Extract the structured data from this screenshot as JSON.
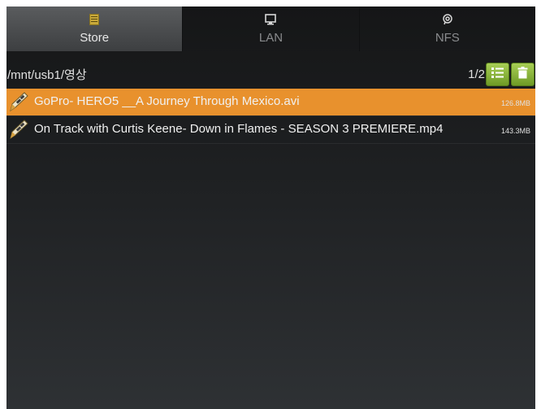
{
  "tabs": [
    {
      "label": "Store",
      "icon": "list-icon",
      "active": true
    },
    {
      "label": "LAN",
      "icon": "monitor-icon",
      "active": false
    },
    {
      "label": "NFS",
      "icon": "network-share-icon",
      "active": false
    }
  ],
  "pathbar": {
    "path": "/mnt/usb1/영상",
    "page_indicator": "1/2",
    "view_button_icon": "list-view-icon",
    "delete_button_icon": "trash-icon"
  },
  "files": [
    {
      "name": "GoPro- HERO5 __A Journey Through Mexico.avi",
      "size": "126.8MB",
      "selected": true,
      "icon": "video-file-icon"
    },
    {
      "name": "On Track with Curtis Keene- Down in Flames - SEASON 3 PREMIERE.mp4",
      "size": "143.3MB",
      "selected": false,
      "icon": "video-file-icon"
    }
  ],
  "colors": {
    "accent": "#e8912d",
    "button": "#8bbb3b",
    "tab_icon_active": "#c9a93a"
  }
}
